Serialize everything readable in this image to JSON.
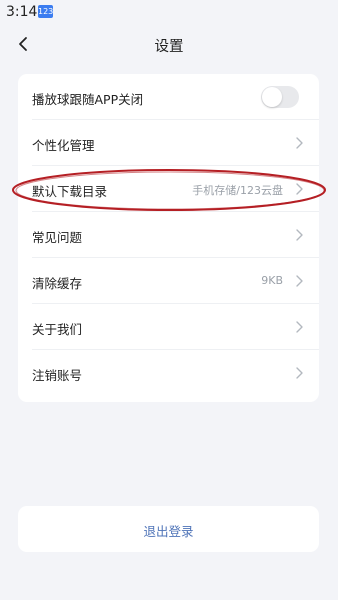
{
  "status_bar": {
    "time": "3:14",
    "badge": "123"
  },
  "header": {
    "title": "设置",
    "back_icon": "chevron-left-icon"
  },
  "settings": {
    "items": [
      {
        "label": "播放球跟随APP关闭",
        "type": "toggle",
        "toggle_on": false
      },
      {
        "label": "个性化管理",
        "value": "",
        "icon": "chevron-right-icon"
      },
      {
        "label": "默认下载目录",
        "value": "手机存储/123云盘",
        "icon": "chevron-right-icon",
        "highlighted": true
      },
      {
        "label": "常见问题",
        "value": "",
        "icon": "chevron-right-icon"
      },
      {
        "label": "清除缓存",
        "value": "9KB",
        "icon": "chevron-right-icon"
      },
      {
        "label": "关于我们",
        "value": "",
        "icon": "chevron-right-icon"
      },
      {
        "label": "注销账号",
        "value": "",
        "icon": "chevron-right-icon"
      }
    ]
  },
  "logout": {
    "label": "退出登录"
  },
  "colors": {
    "background": "#f3f4f8",
    "card": "#ffffff",
    "accent_text": "#4f74b8",
    "annotation": "#b51f24"
  }
}
